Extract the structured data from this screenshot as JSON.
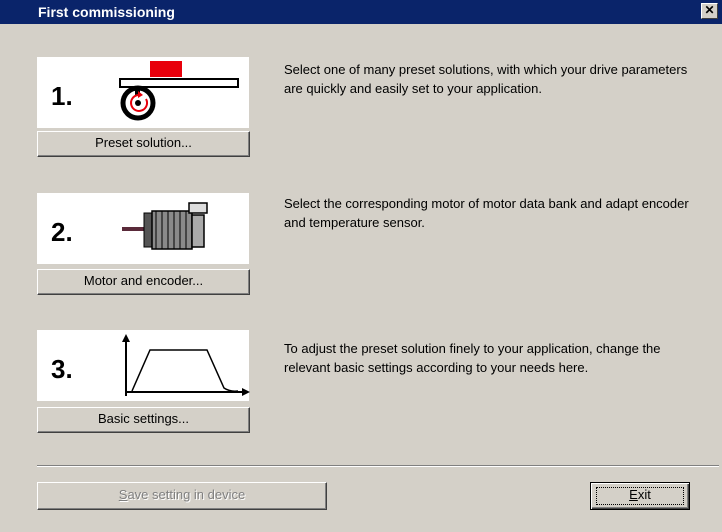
{
  "window": {
    "title": "First commissioning",
    "close_glyph": "✕"
  },
  "steps": [
    {
      "number": "1.",
      "icon": "preset-solution-icon",
      "button_label": "Preset solution...",
      "description": "Select one of many preset solutions, with which your drive parameters are quickly and easily set to your application."
    },
    {
      "number": "2.",
      "icon": "motor-icon",
      "button_label": "Motor and encoder...",
      "description": "Select the corresponding motor of motor data bank and adapt encoder and temperature sensor."
    },
    {
      "number": "3.",
      "icon": "motion-profile-icon",
      "button_label": "Basic settings...",
      "description": "To adjust the preset solution finely to your application, change the relevant basic settings according to your needs here."
    }
  ],
  "footer": {
    "save_label_first": "S",
    "save_label_rest": "ave setting in device",
    "save_enabled": false,
    "exit_label_first": "E",
    "exit_label_rest": "xit"
  },
  "colors": {
    "titlebar": "#0a246a",
    "dialog_bg": "#d4d0c8",
    "card_bg": "#ffffff",
    "cargo_red": "#e8000b"
  }
}
